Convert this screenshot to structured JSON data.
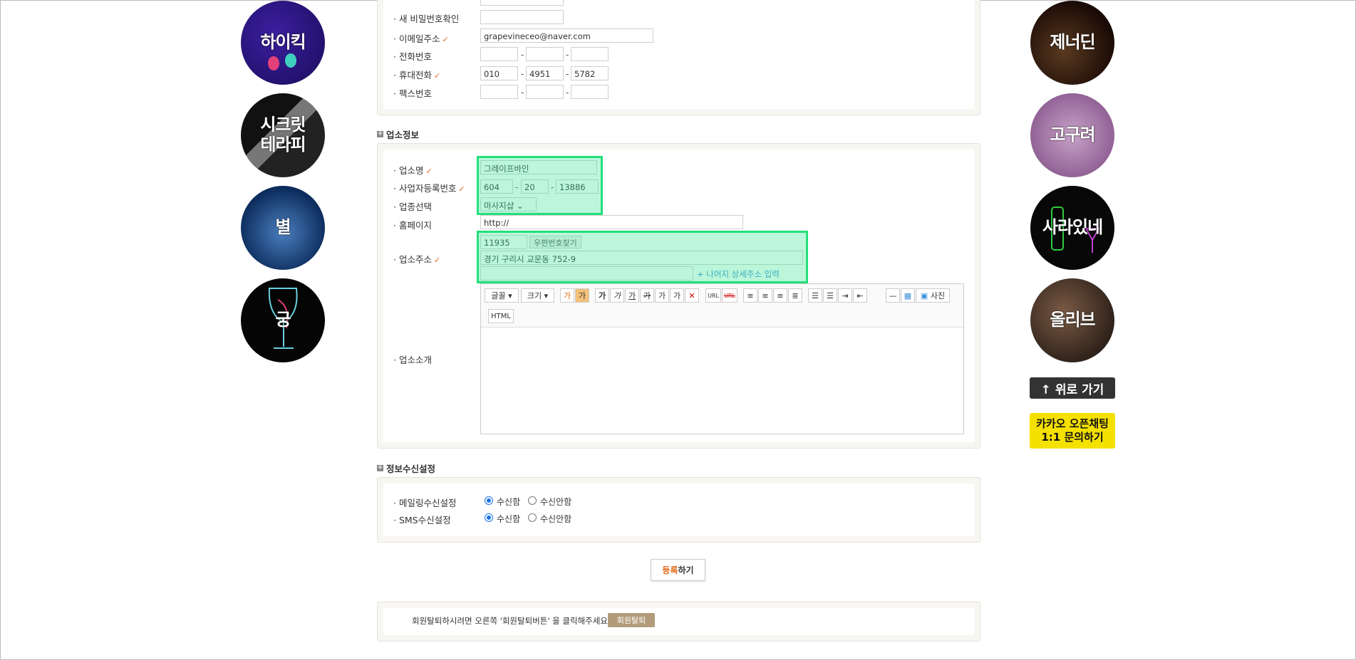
{
  "left_banners": [
    {
      "name": "하이킥"
    },
    {
      "name": "시크릿\n테라피"
    },
    {
      "name": "별"
    },
    {
      "name": "궁"
    }
  ],
  "right_banners": [
    {
      "name": "제너딘"
    },
    {
      "name": "고구려"
    },
    {
      "name": "사라있네"
    },
    {
      "name": "올리브"
    }
  ],
  "scroll_top_label": "↑ 위로 가기",
  "kakao": {
    "line1": "카카오 오픈채팅",
    "line2": "1:1 문의하기"
  },
  "account": {
    "new_pw_confirm_label": "새 비밀번호확인",
    "email_label": "이메일주소",
    "email_value": "grapevineceo@naver.com",
    "phone_label": "전화번호",
    "mobile_label": "휴대전화",
    "mobile": [
      "010",
      "4951",
      "5782"
    ],
    "fax_label": "팩스번호",
    "check": "✓",
    "dash": "-"
  },
  "business": {
    "section_title": "업소정보",
    "name_label": "업소명",
    "name_value": "그레이프바인",
    "reg_label": "사업자등록번호",
    "reg": [
      "604",
      "20",
      "13886"
    ],
    "category_label": "업종선택",
    "category_value": "마사지샵",
    "homepage_label": "홈페이지",
    "homepage_value": "http://",
    "address_label": "업소주소",
    "zip": "11935",
    "zip_button": "우편번호찾기",
    "address1": "경기 구리시 교문동 752-9",
    "address_rest_link": "+ 나머지 상세주소 입력",
    "intro_label": "업소소개"
  },
  "editor": {
    "font": "글꼴",
    "size": "크기",
    "html": "HTML",
    "photo": "사진",
    "url": "URL"
  },
  "subscription": {
    "section_title": "정보수신설정",
    "mail_label": "메일링수신설정",
    "sms_label": "SMS수신설정",
    "yes": "수신함",
    "no": "수신안함"
  },
  "submit": {
    "accent": "등록",
    "rest": "하기"
  },
  "leave": {
    "text": "회원탈퇴하시려면 오른쪽 '회원탈퇴버튼' 을 클릭해주세요.",
    "button": "회원탈퇴"
  },
  "colors": {
    "highlight": "#22e07a",
    "accent": "#e06a1b",
    "link": "#3a8fd8"
  }
}
